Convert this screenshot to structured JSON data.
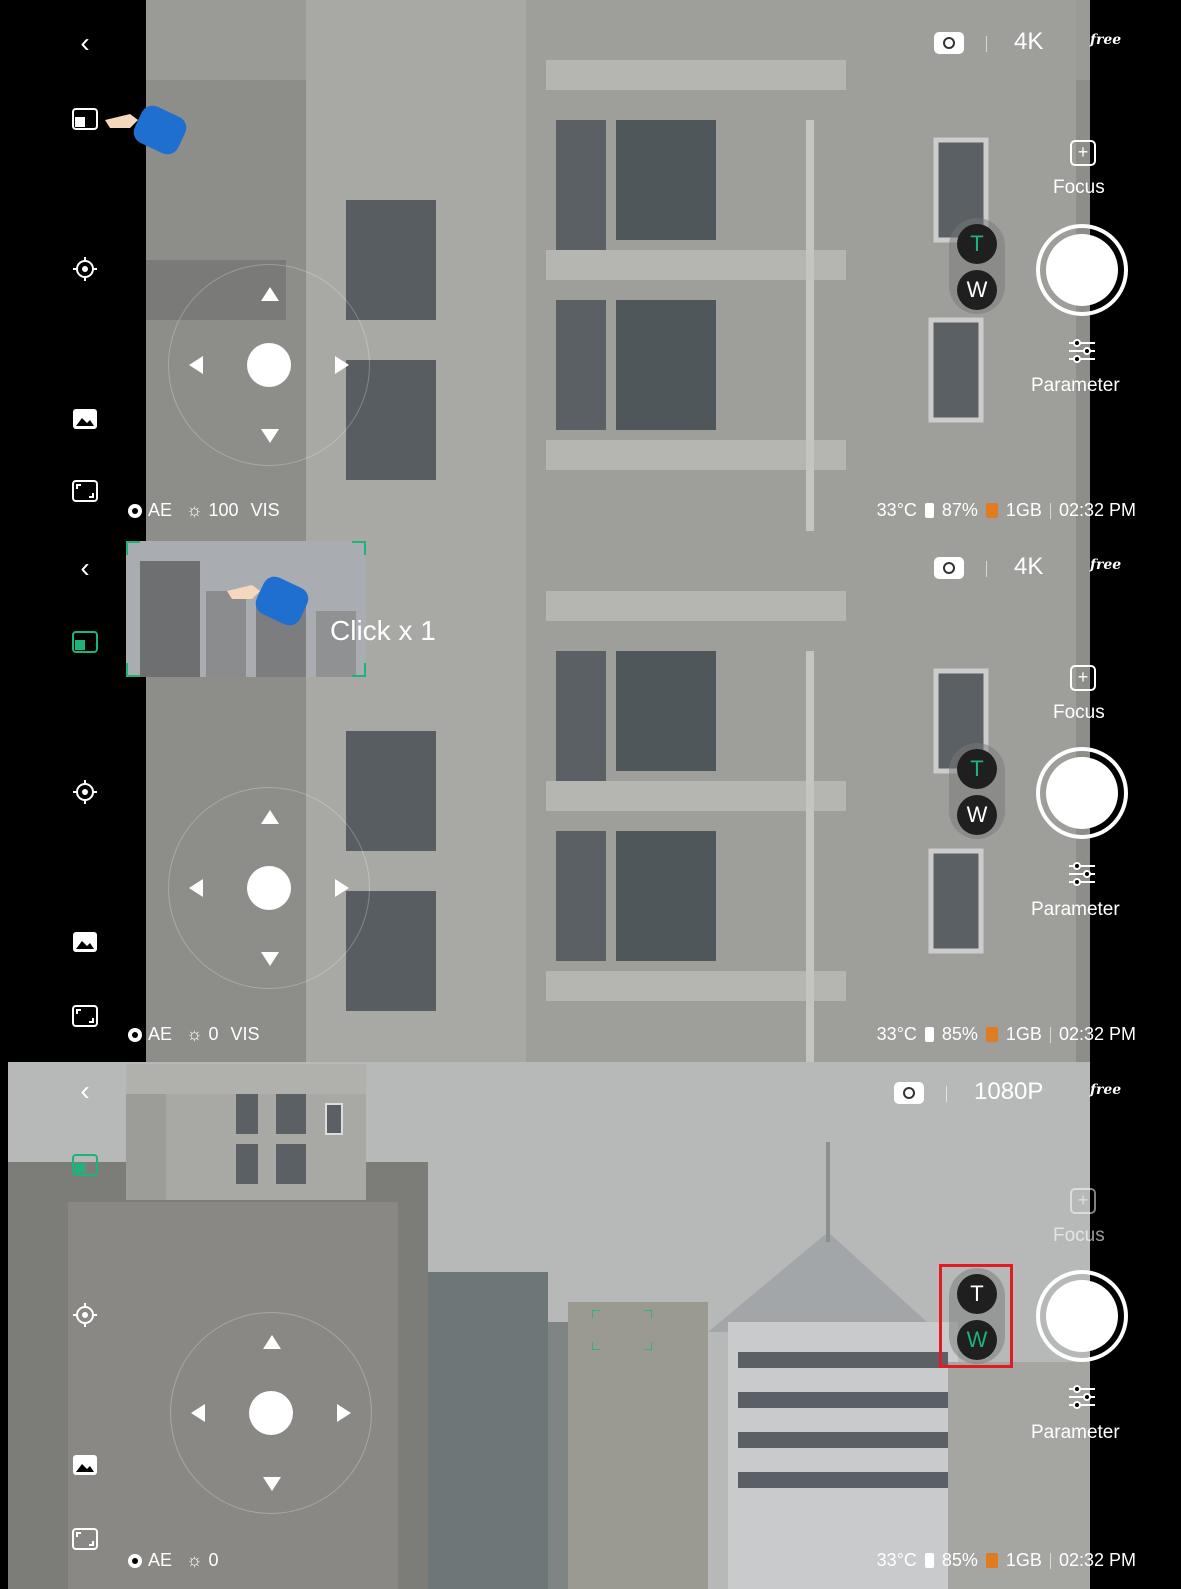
{
  "panels": [
    {
      "resolution": "4K",
      "free_label": "free",
      "focus_label": "Focus",
      "parameter_label": "Parameter",
      "tele_label": "T",
      "wide_label": "W",
      "status_left": {
        "ae": "AE",
        "exposure": "100",
        "mode": "VIS"
      },
      "status_right": {
        "temp": "33°C",
        "battery": "87%",
        "storage": "1GB",
        "time": "02:32 PM"
      }
    },
    {
      "resolution": "4K",
      "free_label": "free",
      "focus_label": "Focus",
      "parameter_label": "Parameter",
      "tele_label": "T",
      "wide_label": "W",
      "click_label": "Click x 1",
      "status_left": {
        "ae": "AE",
        "exposure": "0",
        "mode": "VIS"
      },
      "status_right": {
        "temp": "33°C",
        "battery": "85%",
        "storage": "1GB",
        "time": "02:32 PM"
      }
    },
    {
      "resolution": "1080P",
      "free_label": "free",
      "focus_label": "Focus",
      "parameter_label": "Parameter",
      "tele_label": "T",
      "wide_label": "W",
      "status_left": {
        "ae": "AE",
        "exposure": "0"
      },
      "status_right": {
        "temp": "33°C",
        "battery": "85%",
        "storage": "1GB",
        "time": "02:32 PM"
      }
    }
  ],
  "colors": {
    "accent": "#1db37a",
    "highlight": "#e01b24",
    "sd_card": "#e07b22"
  },
  "icons": [
    "back-icon",
    "pip-toggle-icon",
    "target-icon",
    "gallery-icon",
    "fullscreen-icon",
    "camera-mode-icon",
    "focus-icon",
    "parameter-icon"
  ]
}
